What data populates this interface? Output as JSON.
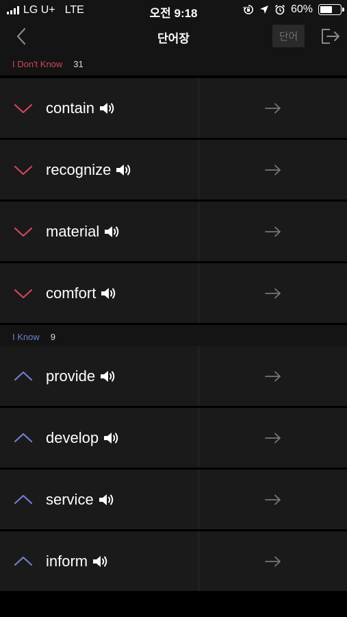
{
  "status_bar": {
    "carrier": "LG U+",
    "network": "LTE",
    "time": "오전 9:18",
    "battery": "60%",
    "battery_level": 0.6
  },
  "nav": {
    "title": "단어장",
    "word_button_label": "단어",
    "back_icon": "chevron-left-icon",
    "exit_icon": "logout-icon"
  },
  "sections": {
    "dont_know": {
      "label": "I Don't Know",
      "count": "31",
      "color": "#d2475c"
    },
    "know": {
      "label": "I Know",
      "count": "9",
      "color": "#6f82d1"
    }
  },
  "dont_know_words": [
    "contain",
    "recognize",
    "material",
    "comfort"
  ],
  "know_words": [
    "provide",
    "develop",
    "service",
    "inform"
  ],
  "icons": {
    "speaker": "speaker-icon",
    "arrow": "arrow-right-icon",
    "expand": "chevron-down-icon",
    "collapse": "chevron-up-icon"
  }
}
